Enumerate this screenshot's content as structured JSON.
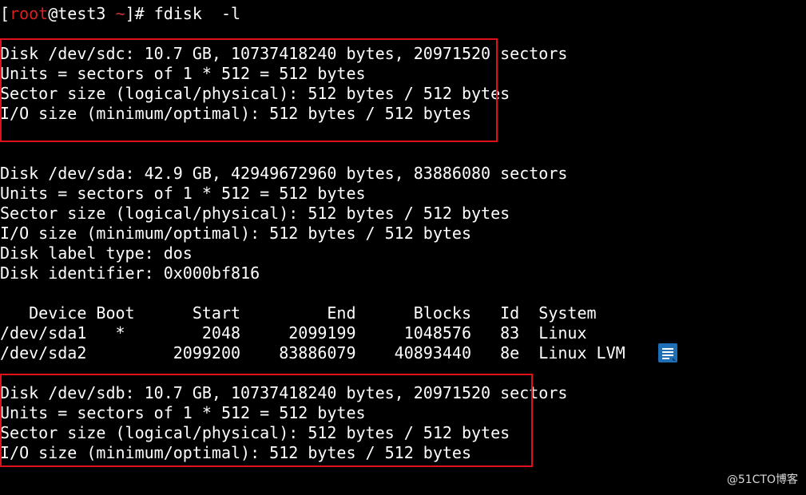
{
  "terminal": {
    "prompt": {
      "open_bracket": "[",
      "user": "root",
      "at_host": "@test3 ",
      "dir": "~",
      "close": "]# ",
      "command": "fdisk  -l"
    },
    "sdc": {
      "line1": "Disk /dev/sdc: 10.7 GB, 10737418240 bytes, 20971520 sectors",
      "line2": "Units = sectors of 1 * 512 = 512 bytes",
      "line3": "Sector size (logical/physical): 512 bytes / 512 bytes",
      "line4": "I/O size (minimum/optimal): 512 bytes / 512 bytes"
    },
    "sda": {
      "line1": "Disk /dev/sda: 42.9 GB, 42949672960 bytes, 83886080 sectors",
      "line2": "Units = sectors of 1 * 512 = 512 bytes",
      "line3": "Sector size (logical/physical): 512 bytes / 512 bytes",
      "line4": "I/O size (minimum/optimal): 512 bytes / 512 bytes",
      "label_type": "Disk label type: dos",
      "identifier": "Disk identifier: 0x000bf816"
    },
    "partition_table": {
      "header": "   Device Boot      Start         End      Blocks   Id  System",
      "rows": [
        "/dev/sda1   *        2048     2099199     1048576   83  Linux",
        "/dev/sda2         2099200    83886079    40893440   8e  Linux LVM"
      ]
    },
    "sdb": {
      "line1": "Disk /dev/sdb: 10.7 GB, 10737418240 bytes, 20971520 sectors",
      "line2": "Units = sectors of 1 * 512 = 512 bytes",
      "line3": "Sector size (logical/physical): 512 bytes / 512 bytes",
      "line4": "I/O size (minimum/optimal): 512 bytes / 512 bytes"
    }
  },
  "overlay": {
    "highlight_color": "#e0101a",
    "note_icon": "note-document-icon",
    "watermark": "@51CTO博客"
  }
}
